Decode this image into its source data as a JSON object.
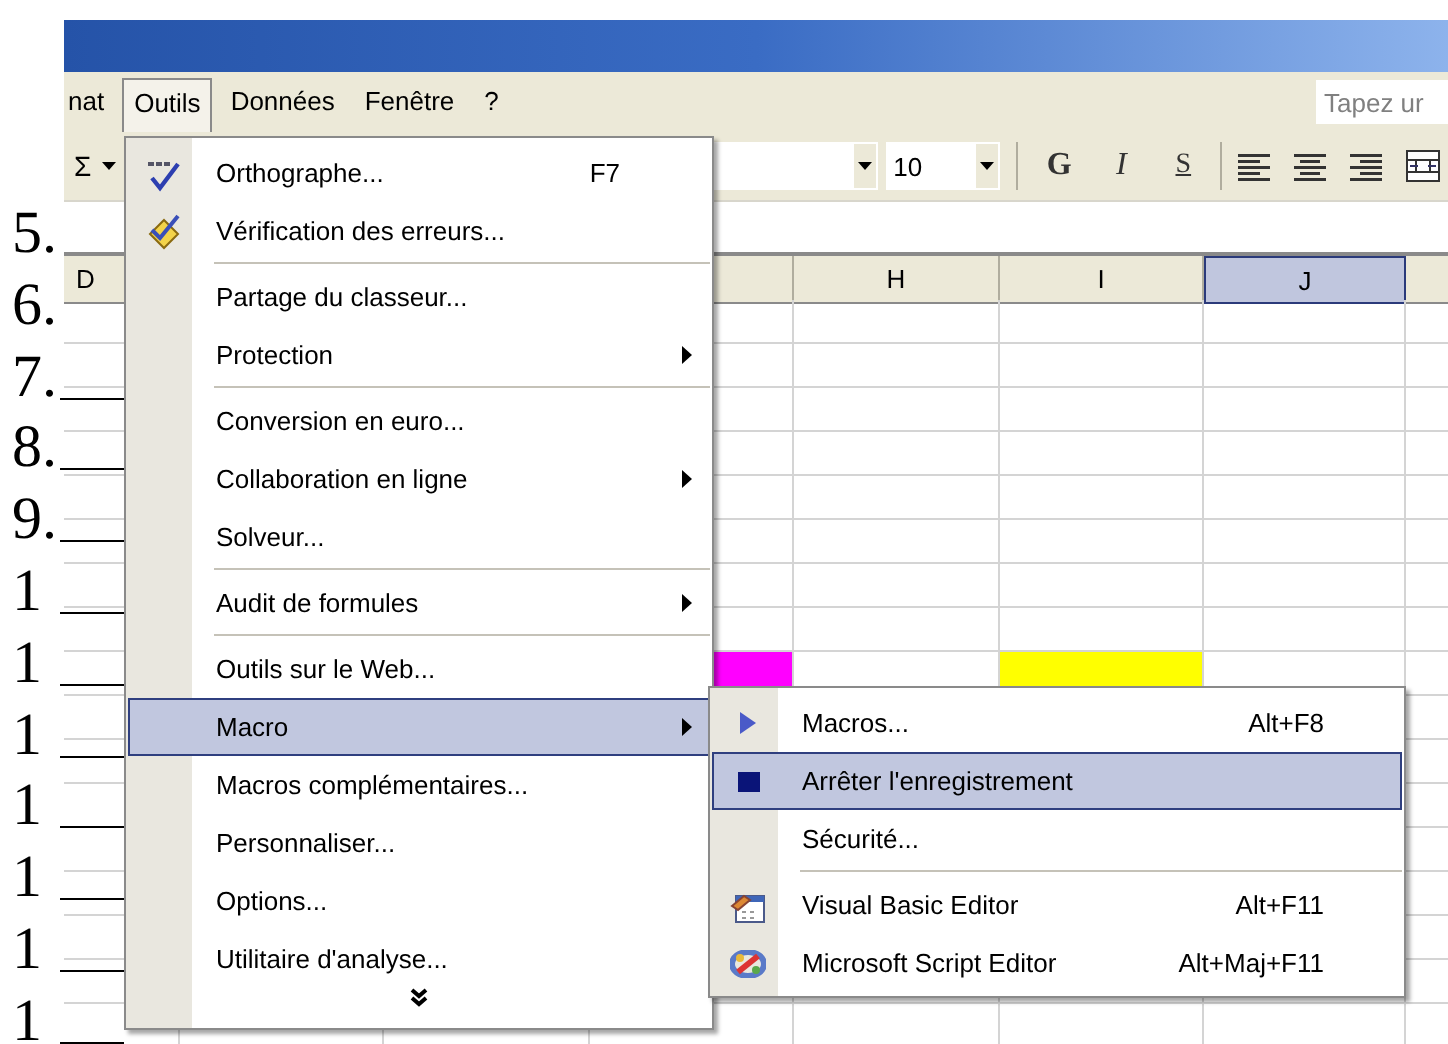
{
  "menu_bar": {
    "items": [
      {
        "label": "nat",
        "open": false
      },
      {
        "label": "Outils",
        "open": true
      },
      {
        "label": "Données",
        "open": false
      },
      {
        "label": "Fenêtre",
        "open": false
      },
      {
        "label": "?",
        "open": false
      }
    ],
    "help_field": {
      "placeholder": "Tapez ur"
    }
  },
  "toolbar": {
    "autosum": "Σ",
    "font_size": "10",
    "format_buttons": [
      {
        "kind": "bold",
        "label": "G"
      },
      {
        "kind": "italic",
        "label": "I"
      },
      {
        "kind": "underline",
        "label": "S"
      }
    ]
  },
  "sheet": {
    "columns": [
      {
        "label": "D",
        "selected": false
      },
      {},
      {},
      {
        "color": "#ff00ff"
      },
      {
        "label": "H",
        "selected": false
      },
      {
        "label": "I",
        "selected": false,
        "color": "#ffff00"
      },
      {
        "label": "J",
        "selected": true
      },
      {}
    ]
  },
  "tools_menu": {
    "items": [
      {
        "kind": "item",
        "label": "Orthographe...",
        "shortcut": "F7",
        "submenu": false,
        "selected": false
      },
      {
        "kind": "item",
        "label": "Vérification des erreurs...",
        "submenu": false,
        "selected": false
      },
      {
        "kind": "separator"
      },
      {
        "kind": "item",
        "label": "Partage du classeur...",
        "submenu": false,
        "selected": false
      },
      {
        "kind": "item",
        "label": "Protection",
        "submenu": true,
        "selected": false
      },
      {
        "kind": "separator"
      },
      {
        "kind": "item",
        "label": "Conversion en euro...",
        "submenu": false,
        "selected": false
      },
      {
        "kind": "item",
        "label": "Collaboration en ligne",
        "submenu": true,
        "selected": false
      },
      {
        "kind": "item",
        "label": "Solveur...",
        "submenu": false,
        "selected": false
      },
      {
        "kind": "separator"
      },
      {
        "kind": "item",
        "label": "Audit de formules",
        "submenu": true,
        "selected": false
      },
      {
        "kind": "separator"
      },
      {
        "kind": "item",
        "label": "Outils sur le Web...",
        "submenu": false,
        "selected": false
      },
      {
        "kind": "item",
        "label": "Macro",
        "submenu": true,
        "selected": true
      },
      {
        "kind": "item",
        "label": "Macros complémentaires...",
        "submenu": false,
        "selected": false
      },
      {
        "kind": "item",
        "label": "Personnaliser...",
        "submenu": false,
        "selected": false
      },
      {
        "kind": "item",
        "label": "Options...",
        "submenu": false,
        "selected": false
      },
      {
        "kind": "item",
        "label": "Utilitaire d'analyse...",
        "submenu": false,
        "selected": false
      },
      {
        "kind": "more"
      }
    ]
  },
  "macro_submenu": {
    "items": [
      {
        "kind": "item",
        "label": "Macros...",
        "shortcut": "Alt+F8",
        "submenu": false,
        "selected": false
      },
      {
        "kind": "item",
        "label": "Arrêter l'enregistrement",
        "submenu": false,
        "selected": true
      },
      {
        "kind": "item",
        "label": "Sécurité...",
        "submenu": false,
        "selected": false
      },
      {
        "kind": "separator"
      },
      {
        "kind": "item",
        "label": "Visual Basic Editor",
        "shortcut": "Alt+F11",
        "submenu": false,
        "selected": false
      },
      {
        "kind": "item",
        "label": "Microsoft Script Editor",
        "shortcut": "Alt+Maj+F11",
        "submenu": false,
        "selected": false
      }
    ]
  },
  "list_numbers": [
    {
      "label": "5.",
      "line": false
    },
    {
      "label": "6.",
      "line": false
    },
    {
      "label": "7.",
      "line": true
    },
    {
      "label": "8.",
      "line": true
    },
    {
      "label": "9.",
      "line": true
    },
    {
      "label": "1",
      "line": true
    },
    {
      "label": "1",
      "line": true
    },
    {
      "label": "1",
      "line": true
    },
    {
      "label": "1",
      "line": true
    },
    {
      "label": "1",
      "line": true
    },
    {
      "label": "1",
      "line": true
    },
    {
      "label": "1",
      "line": true
    }
  ]
}
